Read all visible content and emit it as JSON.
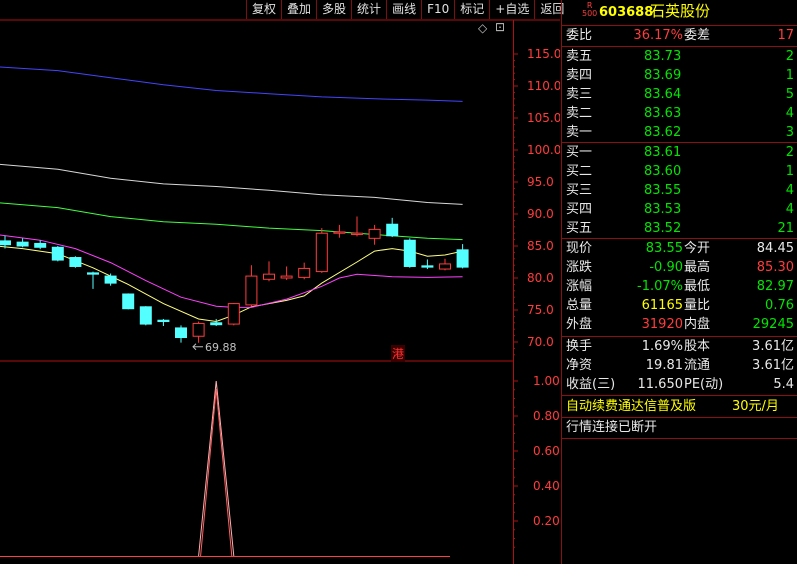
{
  "toolbar": {
    "items": [
      "复权",
      "叠加",
      "多股",
      "统计",
      "画线",
      "F10",
      "标记",
      "+自选",
      "返回"
    ]
  },
  "main_chart": {
    "y_ticks": [
      "115.0",
      "110.0",
      "105.0",
      "100.0",
      "95.0",
      "90.0",
      "85.0",
      "80.0",
      "75.0",
      "70.0"
    ],
    "low_annotation": "69.88",
    "hk_badge": "港",
    "diamond_icon": "◇",
    "expand_icon": "⊡",
    "colors": {
      "up": "#ff3c3c",
      "down": "#54ffff",
      "ma_yellow": "#ffff80",
      "ma_magenta": "#ff40ff",
      "ma_green": "#40ff40",
      "ma_white": "#d8d8d8",
      "ma_blue": "#4444ff",
      "axis": "#b01010"
    }
  },
  "indicator": {
    "y_ticks": [
      "1.00",
      "0.80",
      "0.60",
      "0.40",
      "0.20"
    ]
  },
  "quote": {
    "badge_top": "R",
    "badge_bottom": "500",
    "code": "603688",
    "name": "石英股份",
    "weibi_label": "委比",
    "weibi_value": "36.17%",
    "weicha_label": "委差",
    "weicha_value": "17",
    "sells": [
      {
        "label": "卖五",
        "price": "83.73",
        "vol": "2"
      },
      {
        "label": "卖四",
        "price": "83.69",
        "vol": "1"
      },
      {
        "label": "卖三",
        "price": "83.64",
        "vol": "5"
      },
      {
        "label": "卖二",
        "price": "83.63",
        "vol": "4"
      },
      {
        "label": "卖一",
        "price": "83.62",
        "vol": "3"
      }
    ],
    "buys": [
      {
        "label": "买一",
        "price": "83.61",
        "vol": "2"
      },
      {
        "label": "买二",
        "price": "83.60",
        "vol": "1"
      },
      {
        "label": "买三",
        "price": "83.55",
        "vol": "4"
      },
      {
        "label": "买四",
        "price": "83.53",
        "vol": "4"
      },
      {
        "label": "买五",
        "price": "83.52",
        "vol": "21"
      }
    ],
    "stats": [
      {
        "l1": "现价",
        "v1": "83.55",
        "c1": "green",
        "l2": "今开",
        "v2": "84.45",
        "c2": "white"
      },
      {
        "l1": "涨跌",
        "v1": "-0.90",
        "c1": "green",
        "l2": "最高",
        "v2": "85.30",
        "c2": "red"
      },
      {
        "l1": "涨幅",
        "v1": "-1.07%",
        "c1": "green",
        "l2": "最低",
        "v2": "82.97",
        "c2": "green"
      },
      {
        "l1": "总量",
        "v1": "61165",
        "c1": "yellow",
        "l2": "量比",
        "v2": "0.76",
        "c2": "green"
      },
      {
        "l1": "外盘",
        "v1": "31920",
        "c1": "red",
        "l2": "内盘",
        "v2": "29245",
        "c2": "green"
      }
    ],
    "finance": [
      {
        "l1": "换手",
        "v1": "1.69%",
        "l2": "股本",
        "v2": "3.61亿"
      },
      {
        "l1": "净资",
        "v1": "19.81",
        "l2": "流通",
        "v2": "3.61亿"
      },
      {
        "l1": "收益(三)",
        "v1": "11.650",
        "l2": "PE(动)",
        "v2": "5.4"
      }
    ],
    "ad_text": "自动续费通达信普及版",
    "ad_price": "30元/月",
    "status": "行情连接已断开"
  },
  "chart_data": {
    "type": "candlestick",
    "candles": [
      {
        "o": 85.8,
        "c": 85.2,
        "h": 86.6,
        "l": 84.6
      },
      {
        "o": 85.6,
        "c": 85.0,
        "h": 86.2,
        "l": 84.8
      },
      {
        "o": 85.4,
        "c": 84.8,
        "h": 85.9,
        "l": 84.5
      },
      {
        "o": 84.8,
        "c": 82.8,
        "h": 85.0,
        "l": 82.6
      },
      {
        "o": 83.2,
        "c": 81.8,
        "h": 83.4,
        "l": 81.6
      },
      {
        "o": 80.8,
        "c": 80.6,
        "h": 81.0,
        "l": 78.3
      },
      {
        "o": 80.3,
        "c": 79.2,
        "h": 80.7,
        "l": 78.8
      },
      {
        "o": 77.5,
        "c": 75.2,
        "h": 77.6,
        "l": 75.1
      },
      {
        "o": 75.5,
        "c": 72.8,
        "h": 75.6,
        "l": 72.6
      },
      {
        "o": 73.4,
        "c": 73.2,
        "h": 73.6,
        "l": 72.5
      },
      {
        "o": 72.2,
        "c": 70.7,
        "h": 72.6,
        "l": 69.9
      },
      {
        "o": 70.9,
        "c": 72.9,
        "h": 73.2,
        "l": 69.88
      },
      {
        "o": 73.0,
        "c": 72.7,
        "h": 73.6,
        "l": 72.5
      },
      {
        "o": 72.8,
        "c": 76.0,
        "h": 76.1,
        "l": 72.6
      },
      {
        "o": 75.8,
        "c": 80.3,
        "h": 82.0,
        "l": 75.6
      },
      {
        "o": 79.8,
        "c": 80.6,
        "h": 82.6,
        "l": 79.5
      },
      {
        "o": 80.0,
        "c": 80.3,
        "h": 81.8,
        "l": 79.7
      },
      {
        "o": 80.1,
        "c": 81.5,
        "h": 82.4,
        "l": 79.8
      },
      {
        "o": 81.0,
        "c": 87.0,
        "h": 87.8,
        "l": 80.8
      },
      {
        "o": 87.0,
        "c": 87.2,
        "h": 88.3,
        "l": 86.3
      },
      {
        "o": 86.8,
        "c": 87.0,
        "h": 89.6,
        "l": 86.5
      },
      {
        "o": 86.2,
        "c": 87.6,
        "h": 88.3,
        "l": 85.2
      },
      {
        "o": 88.4,
        "c": 86.6,
        "h": 89.4,
        "l": 86.4
      },
      {
        "o": 85.9,
        "c": 81.8,
        "h": 86.2,
        "l": 81.6
      },
      {
        "o": 81.9,
        "c": 81.7,
        "h": 82.9,
        "l": 81.4
      },
      {
        "o": 81.4,
        "c": 82.2,
        "h": 83.0,
        "l": 81.2
      },
      {
        "o": 84.4,
        "c": 81.7,
        "h": 85.3,
        "l": 81.5
      }
    ],
    "ma_lines": [
      {
        "name": "MA5",
        "color": "#ffff80",
        "points": [
          [
            -0.5,
            85.0
          ],
          [
            1,
            84.6
          ],
          [
            3,
            83.8
          ],
          [
            5,
            81.6
          ],
          [
            7,
            79.0
          ],
          [
            9,
            76.0
          ],
          [
            11,
            73.6
          ],
          [
            12,
            73.2
          ],
          [
            13,
            74.2
          ],
          [
            14,
            75.5
          ],
          [
            16,
            76.5
          ],
          [
            17,
            77.2
          ],
          [
            18,
            79.2
          ],
          [
            20,
            82.5
          ],
          [
            21,
            84.2
          ],
          [
            22,
            84.6
          ],
          [
            23,
            84.2
          ],
          [
            24,
            83.4
          ],
          [
            25,
            83.6
          ],
          [
            26,
            84.2
          ]
        ]
      },
      {
        "name": "MA10",
        "color": "#ff40ff",
        "points": [
          [
            -0.5,
            86.8
          ],
          [
            2,
            85.9
          ],
          [
            4,
            84.6
          ],
          [
            6,
            82.4
          ],
          [
            8,
            79.6
          ],
          [
            10,
            77.0
          ],
          [
            12,
            75.6
          ],
          [
            13,
            75.4
          ],
          [
            14,
            75.4
          ],
          [
            16,
            76.7
          ],
          [
            18,
            78.7
          ],
          [
            19,
            80.0
          ],
          [
            20,
            80.6
          ],
          [
            22,
            80.2
          ],
          [
            24,
            80.1
          ],
          [
            26,
            80.2
          ]
        ]
      },
      {
        "name": "MA20",
        "color": "#40ff40",
        "points": [
          [
            -0.5,
            91.8
          ],
          [
            3,
            91.0
          ],
          [
            6,
            89.6
          ],
          [
            9,
            88.8
          ],
          [
            12,
            88.4
          ],
          [
            15,
            87.8
          ],
          [
            18,
            87.4
          ],
          [
            21,
            86.8
          ],
          [
            24,
            86.2
          ],
          [
            26,
            86.0
          ]
        ]
      },
      {
        "name": "MA30",
        "color": "#d8d8d8",
        "points": [
          [
            -0.5,
            97.8
          ],
          [
            3,
            97.0
          ],
          [
            6,
            95.6
          ],
          [
            9,
            94.7
          ],
          [
            12,
            94.3
          ],
          [
            15,
            93.7
          ],
          [
            18,
            93.0
          ],
          [
            21,
            92.6
          ],
          [
            24,
            91.8
          ],
          [
            26,
            91.5
          ]
        ]
      },
      {
        "name": "MA60",
        "color": "#4444ff",
        "points": [
          [
            -0.5,
            113.0
          ],
          [
            3,
            112.4
          ],
          [
            6,
            111.3
          ],
          [
            9,
            110.2
          ],
          [
            12,
            109.3
          ],
          [
            15,
            108.8
          ],
          [
            18,
            108.3
          ],
          [
            21,
            108.0
          ],
          [
            24,
            107.8
          ],
          [
            26,
            107.6
          ]
        ]
      }
    ],
    "indicator": {
      "values": [
        0,
        0,
        0,
        0,
        0,
        0,
        0,
        0,
        0,
        0,
        0,
        0,
        1,
        0,
        0,
        0,
        0,
        0,
        0,
        0,
        0,
        0,
        0,
        0,
        0,
        0,
        0
      ],
      "ylim": [
        0,
        1.15
      ]
    },
    "ylim": [
      67.0,
      118.5
    ]
  }
}
